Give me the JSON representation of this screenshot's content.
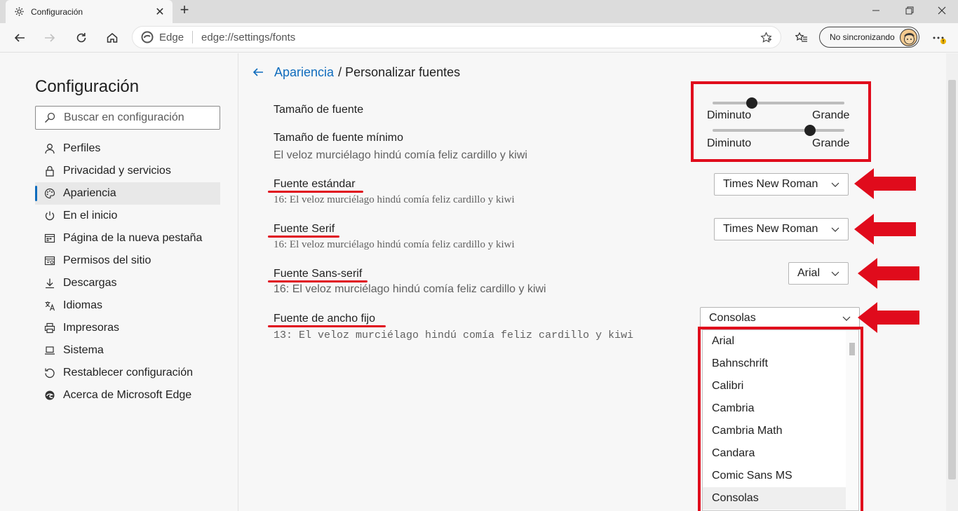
{
  "window": {
    "tab_title": "Configuración",
    "tab_icon": "gear-icon",
    "controls": [
      "minimize-icon",
      "restore-icon",
      "close-icon"
    ]
  },
  "toolbar": {
    "address_brand": "Edge",
    "address_url": "edge://settings/fonts",
    "sync_label": "No sincronizando"
  },
  "sidebar": {
    "title": "Configuración",
    "search_placeholder": "Buscar en configuración",
    "items": [
      {
        "label": "Perfiles",
        "icon": "person-icon"
      },
      {
        "label": "Privacidad y servicios",
        "icon": "lock-icon"
      },
      {
        "label": "Apariencia",
        "icon": "palette-icon",
        "active": true
      },
      {
        "label": "En el inicio",
        "icon": "power-icon"
      },
      {
        "label": "Página de la nueva pestaña",
        "icon": "newtab-page-icon"
      },
      {
        "label": "Permisos del sitio",
        "icon": "site-permissions-icon"
      },
      {
        "label": "Descargas",
        "icon": "download-icon"
      },
      {
        "label": "Idiomas",
        "icon": "language-icon"
      },
      {
        "label": "Impresoras",
        "icon": "printer-icon"
      },
      {
        "label": "Sistema",
        "icon": "laptop-icon"
      },
      {
        "label": "Restablecer configuración",
        "icon": "reset-icon"
      },
      {
        "label": "Acerca de Microsoft Edge",
        "icon": "edge-logo-icon"
      }
    ]
  },
  "main": {
    "breadcrumb_parent": "Apariencia",
    "breadcrumb_current": "/ Personalizar fuentes",
    "font_size": {
      "label": "Tamaño de fuente",
      "min_label": "Diminuto",
      "max_label": "Grande",
      "value_fraction": 0.3
    },
    "min_font_size": {
      "label": "Tamaño de fuente mínimo",
      "sample": "El veloz murciélago hindú comía feliz cardillo y kiwi",
      "min_label": "Diminuto",
      "max_label": "Grande",
      "value_fraction": 0.74
    },
    "standard_font": {
      "label": "Fuente estándar",
      "sample": "16: El veloz murciélago hindú comía feliz cardillo y kiwi",
      "value": "Times New Roman"
    },
    "serif_font": {
      "label": "Fuente Serif",
      "sample": "16: El veloz murciélago hindú comía feliz cardillo y kiwi",
      "value": "Times New Roman"
    },
    "sans_serif_font": {
      "label": "Fuente Sans-serif",
      "sample": "16: El veloz murciélago hindú comía feliz cardillo y kiwi",
      "value": "Arial"
    },
    "fixed_width_font": {
      "label": "Fuente de ancho fijo",
      "sample": "13: El veloz murciélago hindú comía feliz cardillo y kiwi",
      "value": "Consolas",
      "options": [
        "Arial",
        "Bahnschrift",
        "Calibri",
        "Cambria",
        "Cambria Math",
        "Candara",
        "Comic Sans MS",
        "Consolas"
      ],
      "highlighted": "Consolas"
    }
  },
  "annotations": {
    "highlight_color": "#e00b1c",
    "accent_color": "#0f6cbd"
  }
}
